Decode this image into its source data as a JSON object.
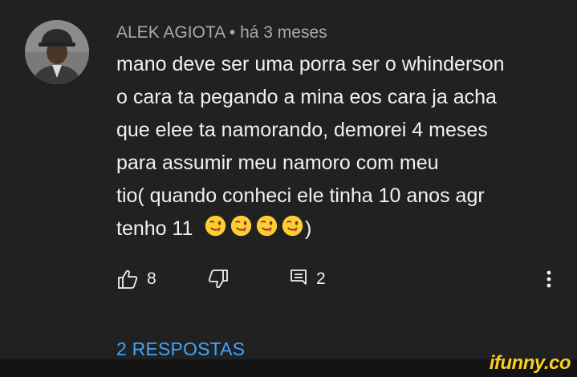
{
  "comment": {
    "author": "ALEK AGIOTA",
    "separator": "•",
    "time": "há 3 meses",
    "lines": [
      "mano deve ser uma porra ser o whinderson",
      "o cara ta pegando a mina eos cara ja acha",
      "que elee ta namorando, demorei 4 meses",
      "para assumir meu namoro com meu",
      "tio( quando conheci ele tinha 10 anos agr",
      "tenho 11"
    ],
    "emoji_icons": [
      "winking-face-tongue-emoji",
      "winking-face-tongue-emoji",
      "winking-face-tongue-emoji",
      "winking-face-tongue-emoji"
    ],
    "closing": ")"
  },
  "actions": {
    "like_count": "8",
    "reply_count": "2",
    "like_icon": "thumbs-up-icon",
    "dislike_icon": "thumbs-down-icon",
    "reply_icon": "comment-icon",
    "menu_icon": "more-vertical-icon"
  },
  "replies": {
    "label": "2 RESPOSTAS"
  },
  "watermark": {
    "text": "ifunny.co"
  },
  "colors": {
    "background": "#212121",
    "text": "#f1f1f1",
    "meta": "#aaaaaa",
    "link": "#3ea6ff",
    "watermark": "#f5d020"
  }
}
